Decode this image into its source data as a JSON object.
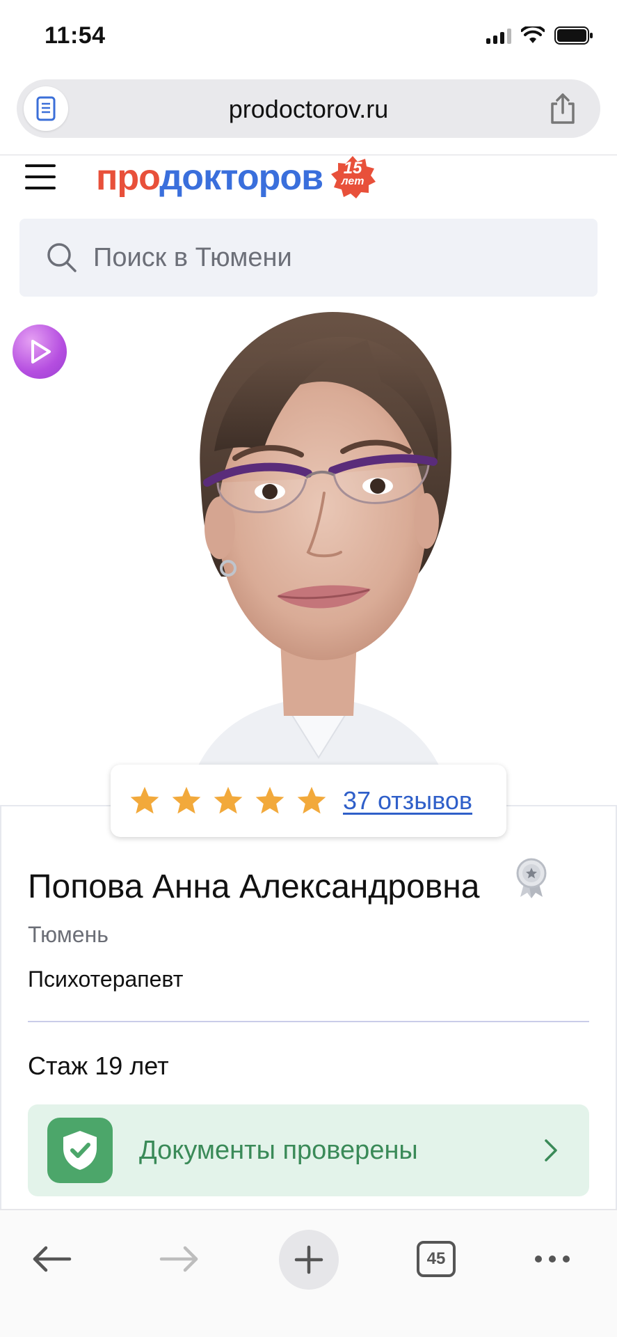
{
  "status_bar": {
    "time": "11:54"
  },
  "browser": {
    "url": "prodoctorov.ru",
    "tab_count": "45"
  },
  "site": {
    "logo_part1": "про",
    "logo_part2": "докторов",
    "logo_badge_number": "15",
    "logo_badge_word": "лет",
    "search_placeholder": "Поиск в Тюмени"
  },
  "doctor": {
    "rating_stars": 5,
    "reviews_link": "37 отзывов",
    "name": "Попова Анна Александровна",
    "city": "Тюмень",
    "specialty": "Психотерапевт",
    "experience": "Стаж 19 лет",
    "documents_status": "Документы проверены"
  },
  "colors": {
    "brand_red": "#e8503a",
    "brand_blue": "#3a6fdc",
    "star": "#f2a93b",
    "link": "#2f5fc9",
    "verified_bg": "#e3f3ea",
    "verified_green": "#4ca66a"
  }
}
